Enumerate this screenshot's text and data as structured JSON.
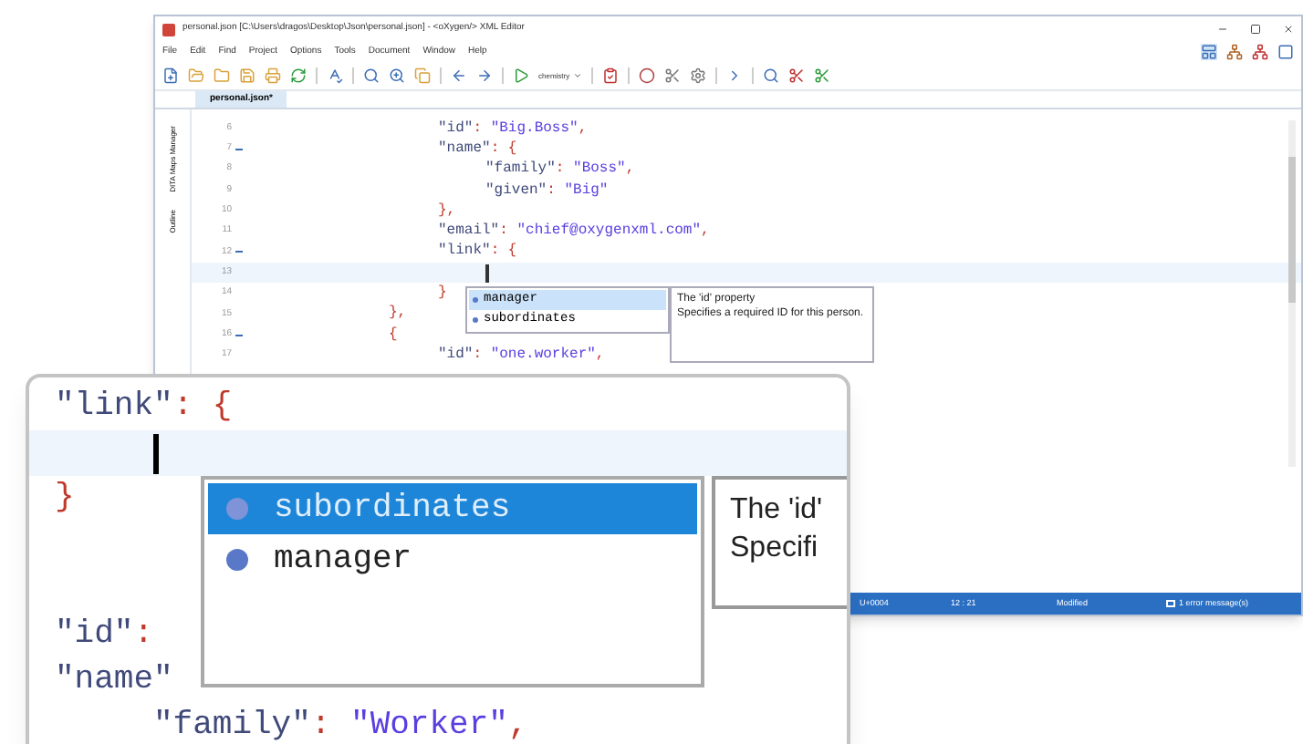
{
  "window": {
    "title": "personal.json [C:\\Users\\dragos\\Desktop\\Json\\personal.json] - <oXygen/> XML Editor"
  },
  "menu": [
    "File",
    "Edit",
    "Find",
    "Project",
    "Options",
    "Tools",
    "Document",
    "Window",
    "Help"
  ],
  "toolbar": {
    "scenario": "chemistry"
  },
  "tabs": [
    {
      "label": "personal.json*",
      "selected": true
    }
  ],
  "side_tabs": [
    {
      "label": "DITA Maps Manager",
      "selected": false
    },
    {
      "label": "Outline",
      "selected": false
    }
  ],
  "editor": {
    "lines": [
      {
        "number": "6",
        "fold": false,
        "current": false,
        "kind": "middle",
        "tokens": [
          {
            "text": "\"id\"",
            "kind": "key"
          },
          {
            "text": ": ",
            "kind": "punct"
          },
          {
            "text": "\"Big.Boss\"",
            "kind": "string"
          },
          {
            "text": ",",
            "kind": "punct"
          }
        ]
      },
      {
        "number": "7",
        "fold": true,
        "current": false,
        "kind": "middle",
        "tokens": [
          {
            "text": "\"name\"",
            "kind": "key"
          },
          {
            "text": ": {",
            "kind": "punct"
          }
        ]
      },
      {
        "number": "8",
        "fold": false,
        "current": false,
        "kind": "inner",
        "tokens": [
          {
            "text": "\"family\"",
            "kind": "key"
          },
          {
            "text": ": ",
            "kind": "punct"
          },
          {
            "text": "\"Boss\"",
            "kind": "string"
          },
          {
            "text": ",",
            "kind": "punct"
          }
        ]
      },
      {
        "number": "9",
        "fold": false,
        "current": false,
        "kind": "inner",
        "tokens": [
          {
            "text": "\"given\"",
            "kind": "key"
          },
          {
            "text": ": ",
            "kind": "punct"
          },
          {
            "text": "\"Big\"",
            "kind": "string"
          }
        ]
      },
      {
        "number": "10",
        "fold": false,
        "current": false,
        "kind": "middle",
        "tokens": [
          {
            "text": "},",
            "kind": "punct"
          }
        ]
      },
      {
        "number": "11",
        "fold": false,
        "current": false,
        "kind": "middle",
        "tokens": [
          {
            "text": "\"email\"",
            "kind": "key"
          },
          {
            "text": ": ",
            "kind": "punct"
          },
          {
            "text": "\"chief@oxygenxml.com\"",
            "kind": "string"
          },
          {
            "text": ",",
            "kind": "punct"
          }
        ]
      },
      {
        "number": "12",
        "fold": true,
        "current": false,
        "kind": "middle",
        "tokens": [
          {
            "text": "\"link\"",
            "kind": "key"
          },
          {
            "text": ": {",
            "kind": "punct"
          }
        ]
      },
      {
        "number": "13",
        "fold": false,
        "current": true,
        "kind": "inner"
      },
      {
        "number": "14",
        "fold": false,
        "current": false,
        "kind": "middle",
        "tokens": [
          {
            "text": "}",
            "kind": "punct"
          }
        ]
      },
      {
        "number": "15",
        "fold": false,
        "current": false,
        "kind": "outer",
        "tokens": [
          {
            "text": "},",
            "kind": "punct"
          }
        ]
      },
      {
        "number": "16",
        "fold": true,
        "current": false,
        "kind": "outer",
        "tokens": [
          {
            "text": "{",
            "kind": "punct"
          }
        ]
      },
      {
        "number": "17",
        "fold": false,
        "current": false,
        "kind": "middle",
        "tokens": [
          {
            "text": "\"id\"",
            "kind": "key"
          },
          {
            "text": ": ",
            "kind": "punct"
          },
          {
            "text": "\"one.worker\"",
            "kind": "string"
          },
          {
            "text": ",",
            "kind": "punct"
          }
        ]
      }
    ],
    "completion": {
      "items": [
        {
          "label": "manager",
          "selected": true
        },
        {
          "label": "subordinates",
          "selected": false
        }
      ],
      "doc_title": "The 'id' property",
      "doc_text": "Specifies a required ID for this person."
    }
  },
  "status_bar": {
    "char": "U+0004",
    "position": "12 : 21",
    "state": "Modified",
    "messages": "1 error message(s)"
  },
  "magnifier": {
    "lines": [
      {
        "current": false,
        "kind": "none",
        "tokens": [
          {
            "text": "\"link\"",
            "kind": "key"
          },
          {
            "text": ": {",
            "kind": "punct"
          }
        ]
      },
      {
        "current": true,
        "kind": "inner"
      },
      {
        "current": false,
        "kind": "none",
        "tokens": [
          {
            "text": "}",
            "kind": "punct"
          }
        ]
      },
      {
        "current": false,
        "kind": "none"
      },
      {
        "current": false,
        "kind": "none"
      },
      {
        "current": false,
        "kind": "none",
        "tokens": [
          {
            "text": "\"id\"",
            "kind": "key"
          },
          {
            "text": ":",
            "kind": "punct"
          }
        ]
      },
      {
        "current": false,
        "kind": "none",
        "tokens": [
          {
            "text": "\"name\"",
            "kind": "key"
          }
        ]
      },
      {
        "current": false,
        "kind": "inner",
        "tokens": [
          {
            "text": "\"family\"",
            "kind": "key"
          },
          {
            "text": ": ",
            "kind": "punct"
          },
          {
            "text": "\"Worker\"",
            "kind": "string"
          },
          {
            "text": ",",
            "kind": "punct"
          }
        ]
      }
    ],
    "completion": {
      "items": [
        {
          "label": "subordinates",
          "selected": true
        },
        {
          "label": "manager",
          "selected": false
        }
      ],
      "doc_title": "The 'id'",
      "doc_text": "Specifi"
    }
  }
}
